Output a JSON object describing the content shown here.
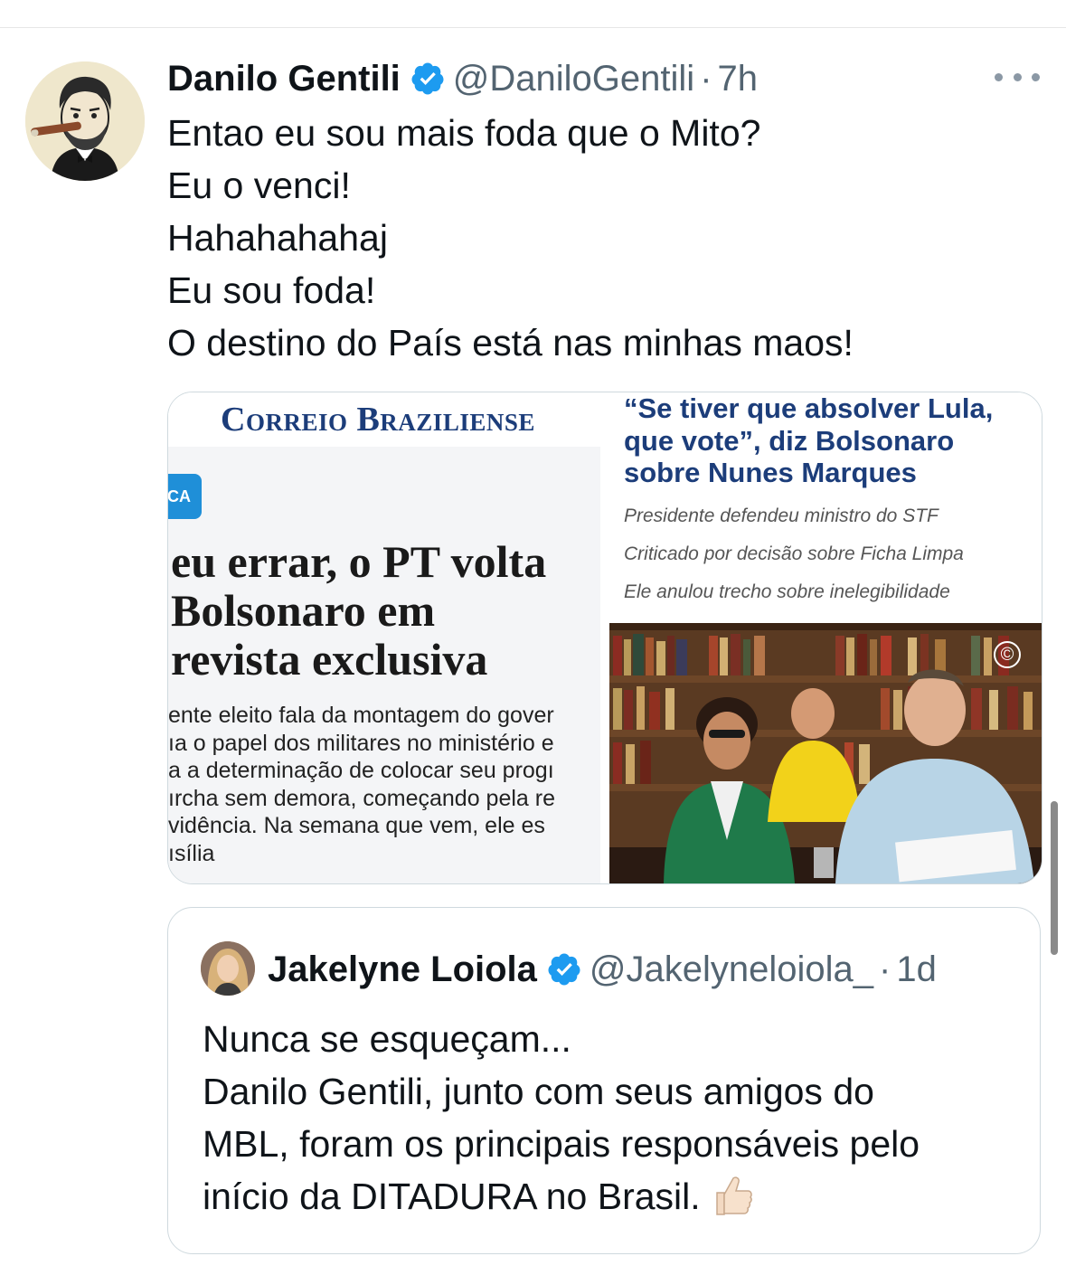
{
  "tweet": {
    "author": "Danilo Gentili",
    "handle": "@DaniloGentili",
    "separator": "·",
    "time": "7h",
    "lines": [
      "Entao eu sou mais foda que o Mito?",
      "Eu o venci!",
      "Hahahahahaj",
      "Eu sou foda!",
      "O destino do País está nas minhas maos!"
    ]
  },
  "media": {
    "newspaper": "Correio Braziliense",
    "tag": "CA",
    "headline": [
      "eu errar, o PT volta",
      "Bolsonaro em",
      "revista exclusiva"
    ],
    "lead": [
      "ente eleito fala da montagem do gover",
      "ıa o papel dos militares no ministério e",
      "a a determinação de colocar seu progı",
      "ırcha sem demora, começando pela re",
      "vidência. Na semana que vem, ele es",
      "ısília"
    ],
    "right_title": "“Se tiver que absolver Lula, que vote”, diz Bolsonaro sobre Nunes Marques",
    "bullets": [
      "Presidente defendeu ministro do STF",
      "Criticado por decisão sobre Ficha Limpa",
      "Ele anulou trecho sobre inelegibilidade"
    ],
    "copyright": "©"
  },
  "quote": {
    "author": "Jakelyne Loiola",
    "handle": "@Jakelyneloiola_",
    "separator": "·",
    "time": "1d",
    "lines": [
      "Nunca se esqueçam...",
      "Danilo Gentili, junto com seus amigos do",
      "MBL, foram os principais responsáveis pelo",
      "início da DITADURA no Brasil."
    ]
  },
  "colors": {
    "verified": "#1d9bf0",
    "secondary_text": "#536471",
    "paper_blue": "#1c3d7a"
  },
  "icons": [
    "verified-badge-icon",
    "more-options-icon",
    "thumbs-up-icon"
  ]
}
